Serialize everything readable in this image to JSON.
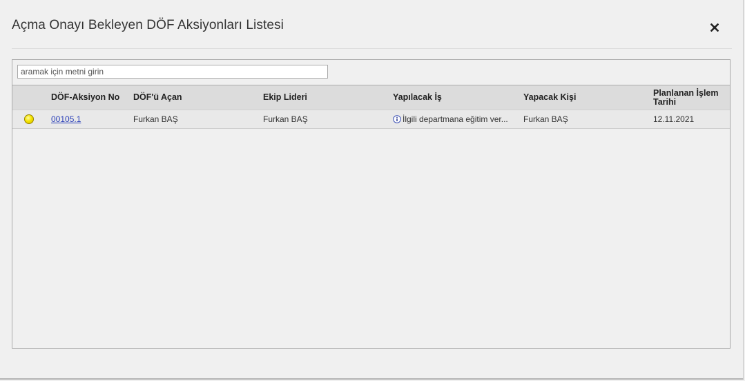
{
  "dialog": {
    "title": "Açma Onayı Bekleyen DÖF Aksiyonları Listesi",
    "close_icon": "close-icon"
  },
  "search": {
    "placeholder": "aramak için metni girin",
    "value": ""
  },
  "table": {
    "columns": [
      {
        "key": "status",
        "label": ""
      },
      {
        "key": "action_no",
        "label": "DÖF-Aksiyon No"
      },
      {
        "key": "opened_by",
        "label": "DÖF'ü Açan"
      },
      {
        "key": "team_leader",
        "label": "Ekip Lideri"
      },
      {
        "key": "task",
        "label": "Yapılacak İş"
      },
      {
        "key": "assignee",
        "label": "Yapacak Kişi"
      },
      {
        "key": "planned_date",
        "label": "Planlanan İşlem Tarihi"
      }
    ],
    "rows": [
      {
        "status": "yellow",
        "action_no": "00105.1",
        "opened_by": "Furkan BAŞ",
        "team_leader": "Furkan BAŞ",
        "task": "İlgili departmana eğitim ver...",
        "assignee": "Furkan BAŞ",
        "planned_date": "12.11.2021"
      }
    ]
  },
  "colors": {
    "link": "#2a3fb8",
    "status_yellow": "#f5e600",
    "header_bg": "#dcdcdc",
    "row_bg": "#e9e9e9"
  }
}
